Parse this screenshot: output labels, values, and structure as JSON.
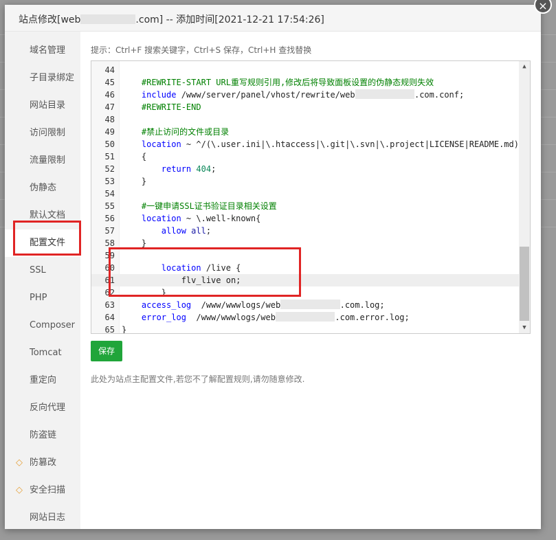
{
  "modal": {
    "title_prefix": "站点修改[web",
    "title_suffix": ".com] -- 添加时间[2021-12-21 17:54:26]",
    "close": "×"
  },
  "sidebar": {
    "items": [
      {
        "label": "域名管理"
      },
      {
        "label": "子目录绑定"
      },
      {
        "label": "网站目录"
      },
      {
        "label": "访问限制"
      },
      {
        "label": "流量限制"
      },
      {
        "label": "伪静态"
      },
      {
        "label": "默认文档"
      },
      {
        "label": "配置文件"
      },
      {
        "label": "SSL"
      },
      {
        "label": "PHP"
      },
      {
        "label": "Composer"
      },
      {
        "label": "Tomcat"
      },
      {
        "label": "重定向"
      },
      {
        "label": "反向代理"
      },
      {
        "label": "防盗链"
      },
      {
        "label": "防篡改",
        "icon": "gem-icon"
      },
      {
        "label": "安全扫描",
        "icon": "gem-icon"
      },
      {
        "label": "网站日志"
      }
    ],
    "active": "配置文件"
  },
  "editor": {
    "hint": "提示：Ctrl+F 搜索关键字，Ctrl+S 保存，Ctrl+H 查找替换",
    "lines": [
      {
        "n": "44",
        "text": ""
      },
      {
        "n": "45",
        "text": "    #REWRITE-START URL重写规则引用,修改后将导致面板设置的伪静态规则失效"
      },
      {
        "n": "46",
        "text": "    include /www/server/panel/vhost/rewrite/web            .com.conf;"
      },
      {
        "n": "47",
        "text": "    #REWRITE-END"
      },
      {
        "n": "48",
        "text": ""
      },
      {
        "n": "49",
        "text": "    #禁止访问的文件或目录"
      },
      {
        "n": "50",
        "text": "    location ~ ^/(\\.user.ini|\\.htaccess|\\.git|\\.svn|\\.project|LICENSE|README.md)"
      },
      {
        "n": "51",
        "text": "    {"
      },
      {
        "n": "52",
        "text": "        return 404;"
      },
      {
        "n": "53",
        "text": "    }"
      },
      {
        "n": "54",
        "text": ""
      },
      {
        "n": "55",
        "text": "    #一键申请SSL证书验证目录相关设置"
      },
      {
        "n": "56",
        "text": "    location ~ \\.well-known{"
      },
      {
        "n": "57",
        "text": "        allow all;"
      },
      {
        "n": "58",
        "text": "    }"
      },
      {
        "n": "59",
        "text": ""
      },
      {
        "n": "60",
        "text": "        location /live {"
      },
      {
        "n": "61",
        "text": "            flv_live on;"
      },
      {
        "n": "62",
        "text": "        }"
      },
      {
        "n": "63",
        "text": "    access_log  /www/wwwlogs/web            .com.log;"
      },
      {
        "n": "64",
        "text": "    error_log  /www/wwwlogs/web            .com.error.log;"
      },
      {
        "n": "65",
        "text": "}"
      }
    ],
    "highlighted_line": "61"
  },
  "save_button": "保存",
  "note": "此处为站点主配置文件,若您不了解配置规则,请勿随意修改."
}
